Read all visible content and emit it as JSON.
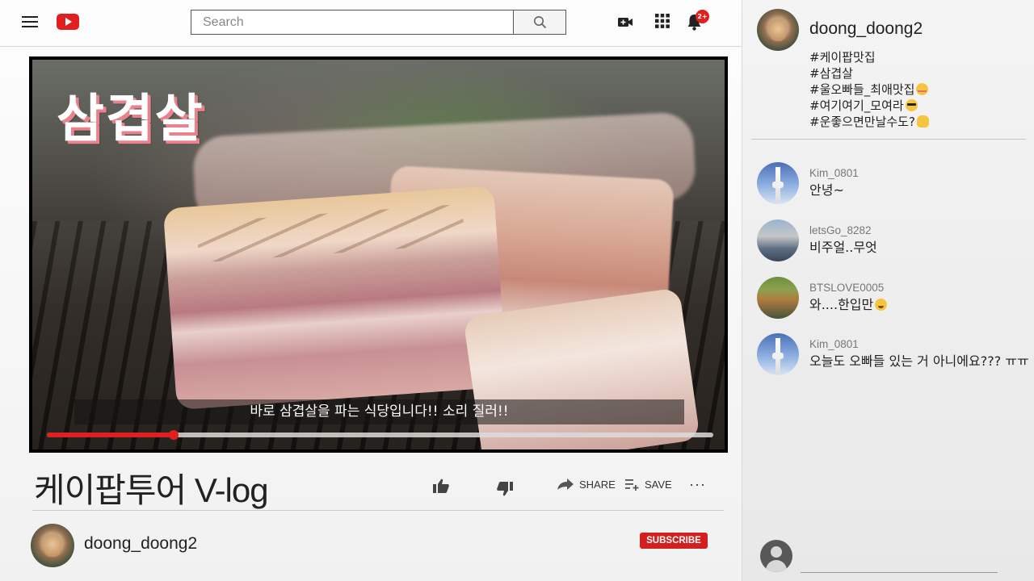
{
  "header": {
    "search_placeholder": "Search",
    "notification_count": "2+",
    "brand_color": "#e0201e"
  },
  "video": {
    "overlay_title": "삼겹살",
    "subtitle": "바로 삼겹살을 파는 식당입니다!! 소리 질러!!",
    "progress": 0.19,
    "progress_color": "#e0201e",
    "title": "케이팝투어 V-log"
  },
  "actions": {
    "share_label": "SHARE",
    "save_label": "SAVE",
    "more_label": "···"
  },
  "channel": {
    "name": "doong_doong2",
    "subscribe_label": "SUBSCRIBE"
  },
  "sidebar": {
    "host_name": "doong_doong2",
    "tags": [
      "#케이팝맛집",
      "#삼겹살",
      "#울오빠들_최애맛집",
      "#여기여기_모여라",
      "#운좋으면만날수도?"
    ],
    "comments": [
      {
        "user": "Kim_0801",
        "message": "안녕~"
      },
      {
        "user": "letsGo_8282",
        "message": "비주얼..무엇"
      },
      {
        "user": "BTSLOVE0005",
        "message": "와....한입만"
      },
      {
        "user": "Kim_0801",
        "message": "오늘도 오빠들 있는 거 아니에요??? ㅠㅠ"
      }
    ]
  }
}
